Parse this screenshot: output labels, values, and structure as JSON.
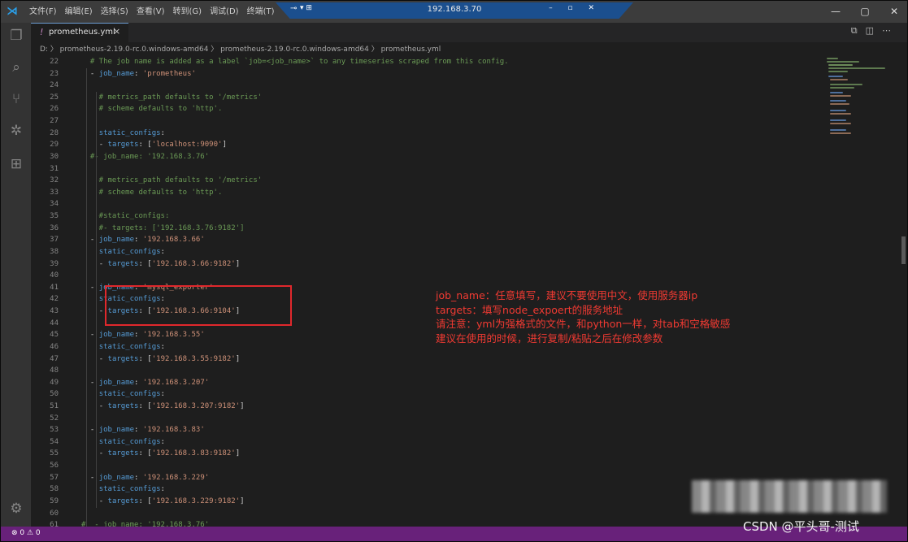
{
  "titlebar": {
    "menu": [
      "文件(F)",
      "编辑(E)",
      "选择(S)",
      "查看(V)",
      "转到(G)",
      "调试(D)",
      "终端(T)"
    ],
    "remote_host": "192.168.3.70",
    "window_controls": {
      "minimize": "—",
      "maximize": "▢",
      "close": "✕"
    }
  },
  "activity_bar": {
    "items": [
      "explorer-icon",
      "search-icon",
      "source-control-icon",
      "debug-icon",
      "extensions-icon",
      "settings-gear-icon"
    ]
  },
  "tab": {
    "label": "prometheus.yml",
    "close": "×"
  },
  "breadcrumb": {
    "text": "D: 〉 prometheus-2.19.0-rc.0.windows-amd64 〉 prometheus-2.19.0-rc.0.windows-amd64 〉  prometheus.yml"
  },
  "editor": {
    "lines": [
      {
        "n": "22",
        "code": "  # The job name is added as a label `job=<job_name>` to any timeseries scraped from this config."
      },
      {
        "n": "23",
        "code": "  - job_name: 'prometheus'"
      },
      {
        "n": "24",
        "code": ""
      },
      {
        "n": "25",
        "code": "    # metrics_path defaults to '/metrics'"
      },
      {
        "n": "26",
        "code": "    # scheme defaults to 'http'."
      },
      {
        "n": "27",
        "code": ""
      },
      {
        "n": "28",
        "code": "    static_configs:"
      },
      {
        "n": "29",
        "code": "    - targets: ['localhost:9090']"
      },
      {
        "n": "30",
        "code": "  #- job_name: '192.168.3.76'"
      },
      {
        "n": "31",
        "code": ""
      },
      {
        "n": "32",
        "code": "    # metrics_path defaults to '/metrics'"
      },
      {
        "n": "33",
        "code": "    # scheme defaults to 'http'."
      },
      {
        "n": "34",
        "code": ""
      },
      {
        "n": "35",
        "code": "    #static_configs:"
      },
      {
        "n": "36",
        "code": "    #- targets: ['192.168.3.76:9182']"
      },
      {
        "n": "37",
        "code": "  - job_name: '192.168.3.66'"
      },
      {
        "n": "38",
        "code": "    static_configs:"
      },
      {
        "n": "39",
        "code": "    - targets: ['192.168.3.66:9182']"
      },
      {
        "n": "40",
        "code": ""
      },
      {
        "n": "41",
        "code": "  - job_name: 'mysql_exporter'"
      },
      {
        "n": "42",
        "code": "    static_configs:"
      },
      {
        "n": "43",
        "code": "    - targets: ['192.168.3.66:9104']"
      },
      {
        "n": "44",
        "code": ""
      },
      {
        "n": "45",
        "code": "  - job_name: '192.168.3.55'"
      },
      {
        "n": "46",
        "code": "    static_configs:"
      },
      {
        "n": "47",
        "code": "    - targets: ['192.168.3.55:9182']"
      },
      {
        "n": "48",
        "code": ""
      },
      {
        "n": "49",
        "code": "  - job_name: '192.168.3.207'"
      },
      {
        "n": "50",
        "code": "    static_configs:"
      },
      {
        "n": "51",
        "code": "    - targets: ['192.168.3.207:9182']"
      },
      {
        "n": "52",
        "code": ""
      },
      {
        "n": "53",
        "code": "  - job_name: '192.168.3.83'"
      },
      {
        "n": "54",
        "code": "    static_configs:"
      },
      {
        "n": "55",
        "code": "    - targets: ['192.168.3.83:9182']"
      },
      {
        "n": "56",
        "code": ""
      },
      {
        "n": "57",
        "code": "  - job_name: '192.168.3.229'"
      },
      {
        "n": "58",
        "code": "    static_configs:"
      },
      {
        "n": "59",
        "code": "    - targets: ['192.168.3.229:9182']"
      },
      {
        "n": "60",
        "code": ""
      },
      {
        "n": "61",
        "code": "#  - job_name: '192.168.3.76'"
      }
    ]
  },
  "annotation": {
    "lines": [
      "job_name：任意填写，建议不要使用中文，使用服务器ip",
      "targets：填写node_expoert的服务地址",
      "请注意：yml为强格式的文件，和python一样，对tab和空格敏感",
      "建议在使用的时候，进行复制/粘贴之后在修改参数"
    ]
  },
  "statusbar": {
    "problems": "⊗ 0 ⚠ 0"
  },
  "watermark": "CSDN @平头哥-测试",
  "colors": {
    "accent": "#68217a",
    "highlight_box": "#e0282c",
    "annotation_text": "#f03a32"
  }
}
